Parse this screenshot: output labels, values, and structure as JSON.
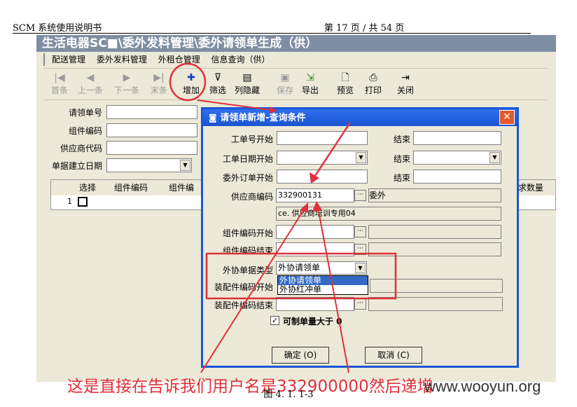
{
  "doc": {
    "title": "SCM 系统使用说明书",
    "page": "第 17 页 / 共 54 页",
    "figure_caption": "图 4. 1. 1-3"
  },
  "app": {
    "title": "生活电器SC■\\委外发料管理\\委外请领单生成（供）",
    "menu": [
      "配送管理",
      "委外发料管理",
      "外租仓管理",
      "信息查询（供）"
    ],
    "toolbar": [
      {
        "label": "首条",
        "icon": "first-record-icon",
        "glyph": "|◀",
        "enabled": false
      },
      {
        "label": "上一条",
        "icon": "prev-record-icon",
        "glyph": "◀",
        "enabled": false
      },
      {
        "label": "下一条",
        "icon": "next-record-icon",
        "glyph": "▶",
        "enabled": false
      },
      {
        "label": "末条",
        "icon": "last-record-icon",
        "glyph": "▶|",
        "enabled": false
      },
      {
        "label": "增加",
        "icon": "add-icon",
        "glyph": "✚",
        "enabled": true
      },
      {
        "label": "筛选",
        "icon": "filter-icon",
        "glyph": "⊽",
        "enabled": true
      },
      {
        "label": "列隐藏",
        "icon": "column-hide-icon",
        "glyph": "▤",
        "enabled": true
      },
      {
        "label": "保存",
        "icon": "save-icon",
        "glyph": "▣",
        "enabled": false
      },
      {
        "label": "导出",
        "icon": "export-icon",
        "glyph": "⇲",
        "enabled": true
      },
      {
        "label": "预览",
        "icon": "preview-icon",
        "glyph": "🗋",
        "enabled": true
      },
      {
        "label": "打印",
        "icon": "print-icon",
        "glyph": "⎙",
        "enabled": true
      },
      {
        "label": "关闭",
        "icon": "close-door-icon",
        "glyph": "⇥",
        "enabled": true
      }
    ],
    "form": {
      "req_no": "请领单号",
      "part_code": "组件编码",
      "supplier_code": "供应商代码",
      "build_date": "单据建立日期"
    },
    "grid": {
      "headers": [
        "选择",
        "组件编码",
        "组件编",
        "求数量"
      ],
      "row_index": "1"
    }
  },
  "dialog": {
    "title": "请领单新增-查询条件",
    "fields": {
      "ticket_start": "工单号开始",
      "ticket_end": "结束",
      "ticket_date_start": "工单日期开始",
      "ticket_date_end": "结束",
      "order_start": "委外订单开始",
      "order_end": "结束",
      "supplier_code": "供应商编码",
      "supplier_value": "332900131",
      "supplier_type": "委外",
      "supplier_name": "ce. 供应商培训专用04",
      "part_start": "组件编码开始",
      "part_end": "组件编码结束",
      "doc_type": "外协单据类型",
      "doc_type_value": "外协请领单",
      "assy_start": "装配件编码开始",
      "assy_end": "装配件编码结束",
      "qty_check": "可制单量大于 0"
    },
    "dropdown_options": [
      "外协请领单",
      "外协红冲单"
    ],
    "ok": "确定 (O)",
    "cancel": "取消 (C)"
  },
  "annotation": "这是直接在告诉我们用户名是332900000然后递增",
  "watermark": "www.wooyun.org",
  "colors": {
    "annotation_red": "#e0303a",
    "dialog_blue": "#1b56d8"
  }
}
